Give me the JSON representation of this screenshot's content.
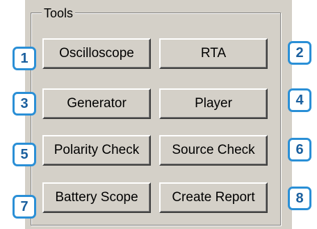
{
  "groupbox": {
    "title": "Tools"
  },
  "buttons": [
    {
      "label": "Oscilloscope"
    },
    {
      "label": "RTA"
    },
    {
      "label": "Generator"
    },
    {
      "label": "Player"
    },
    {
      "label": "Polarity Check"
    },
    {
      "label": "Source Check"
    },
    {
      "label": "Battery Scope"
    },
    {
      "label": "Create Report"
    }
  ],
  "badges": [
    "1",
    "2",
    "3",
    "4",
    "5",
    "6",
    "7",
    "8"
  ],
  "colors": {
    "badge_border": "#2a8fd6",
    "badge_text": "#1a5f9e",
    "panel_bg": "#d4d0c8"
  }
}
